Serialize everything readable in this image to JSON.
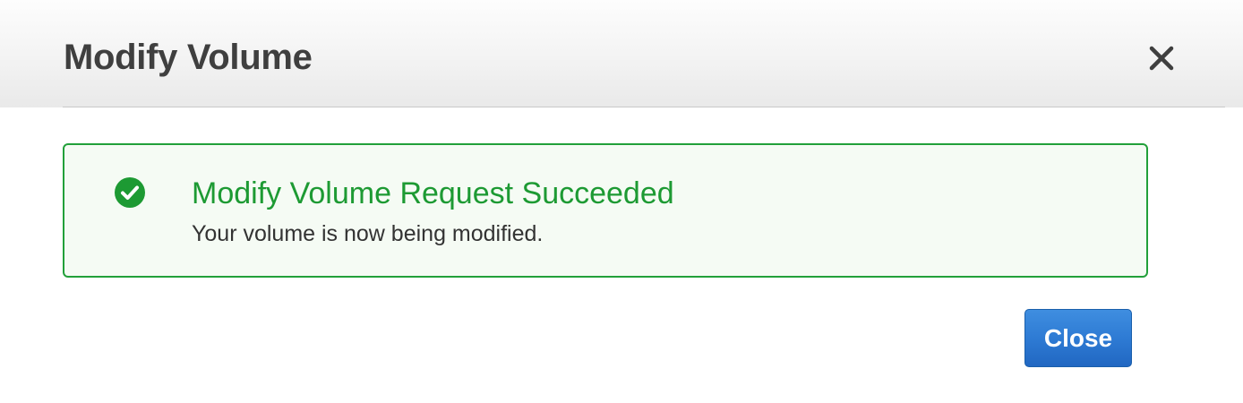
{
  "dialog": {
    "title": "Modify Volume",
    "close_icon": "close-icon"
  },
  "alert": {
    "icon": "check-circle-icon",
    "title": "Modify Volume Request Succeeded",
    "message": "Your volume is now being modified.",
    "accent_color": "#1d9a33",
    "background_color": "#f5fbf4"
  },
  "footer": {
    "close_label": "Close",
    "button_color": "#2e7bd4"
  }
}
